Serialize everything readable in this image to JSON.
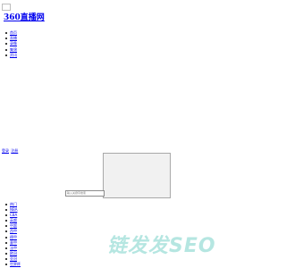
{
  "header": {
    "broken_image_alt": "▫",
    "logo_text": "360直播网"
  },
  "nav": {
    "items": [
      "首页",
      "直播",
      "录像",
      "集锦",
      "资讯"
    ]
  },
  "auth": {
    "login": "登录",
    "register": "注册"
  },
  "search": {
    "placeholder": "输入关键字搜索"
  },
  "channels": {
    "items": [
      "热门",
      "NBA",
      "CBA",
      "英超",
      "中超",
      "西甲",
      "德甲",
      "意甲",
      "法甲",
      "欧冠",
      "亚冠",
      "世界杯"
    ]
  },
  "watermark": {
    "text": "链发发SEO"
  }
}
